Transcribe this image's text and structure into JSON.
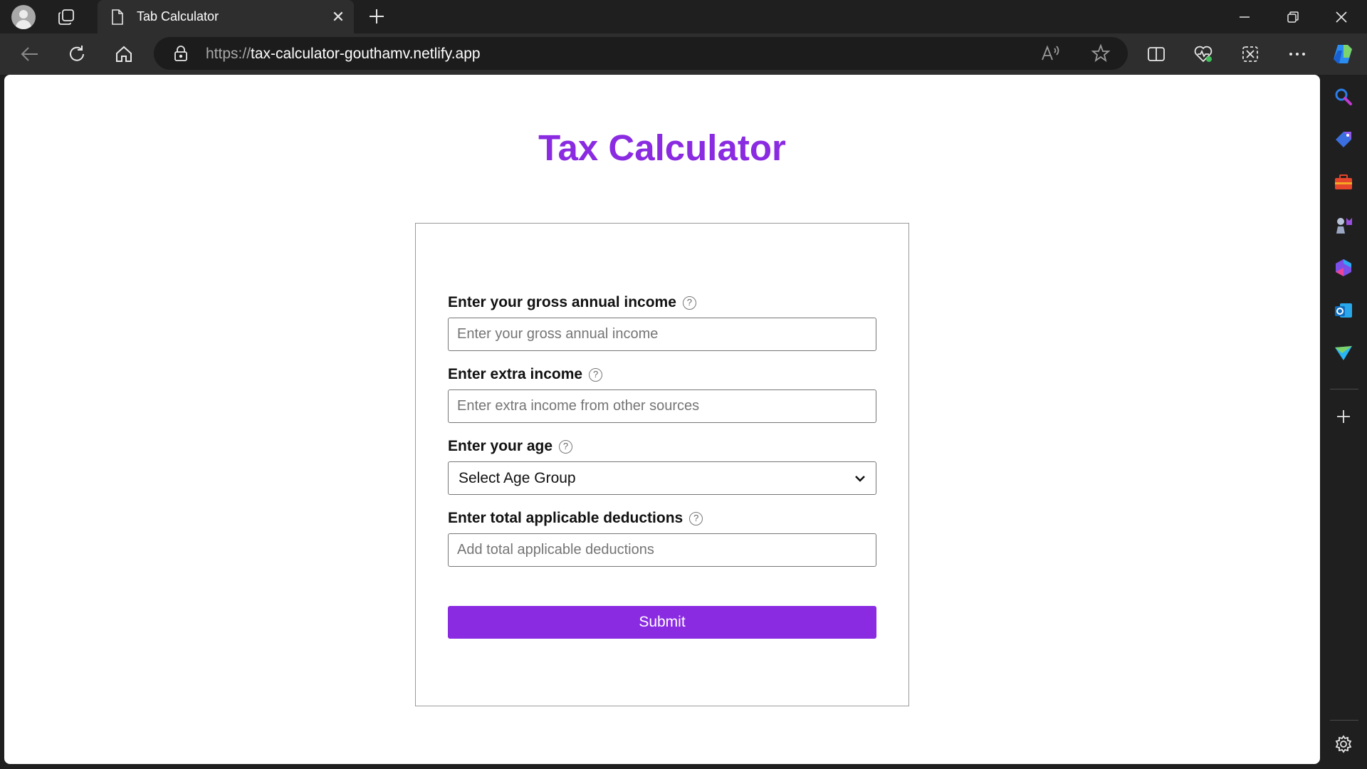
{
  "browser": {
    "tab_title": "Tab Calculator",
    "url_protocol": "https://",
    "url_host": "tax-calculator-gouthamv.netlify.app"
  },
  "page": {
    "heading": "Tax Calculator",
    "form": {
      "gross_income": {
        "label": "Enter your gross annual income",
        "placeholder": "Enter your gross annual income",
        "help": "?"
      },
      "extra_income": {
        "label": "Enter extra income",
        "placeholder": "Enter extra income from other sources",
        "help": "?"
      },
      "age": {
        "label": "Enter your age",
        "selected": "Select Age Group",
        "help": "?"
      },
      "deductions": {
        "label": "Enter total applicable deductions",
        "placeholder": "Add total applicable deductions",
        "help": "?"
      },
      "submit_label": "Submit"
    }
  },
  "colors": {
    "accent": "#8a2be2",
    "chrome_dark": "#1f1f1f",
    "chrome_toolbar": "#2e2e2e"
  }
}
